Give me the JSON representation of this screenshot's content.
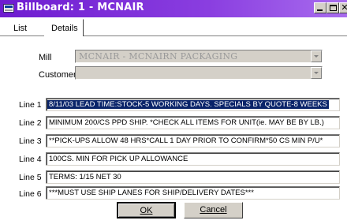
{
  "window": {
    "title": "Billboard: 1 - MCNAIR"
  },
  "tabs": [
    {
      "label": "List"
    },
    {
      "label": "Details"
    }
  ],
  "form": {
    "mill_label": "Mill",
    "mill_value": "MCNAIR - MCNAIRN PACKAGING",
    "customer_label": "Customer",
    "customer_value": ""
  },
  "lines": [
    {
      "label": "Line 1",
      "value": "8/11/03 LEAD TIME:STOCK-5 WORKING DAYS. SPECIALS BY QUOTE-8 WEEKS"
    },
    {
      "label": "Line 2",
      "value": "MINIMUM 200/CS PPD SHIP. *CHECK ALL ITEMS FOR UNIT(ie. MAY BE BY LB.)"
    },
    {
      "label": "Line 3",
      "value": "**PICK-UPS ALLOW 48 HRS*CALL 1 DAY PRIOR TO CONFIRM*50 CS MIN P/U*"
    },
    {
      "label": "Line 4",
      "value": "100CS. MIN FOR PICK UP ALLOWANCE"
    },
    {
      "label": "Line 5",
      "value": "TERMS: 1/15 NET 30"
    },
    {
      "label": "Line 6",
      "value": "***MUST USE SHIP LANES FOR SHIP/DELIVERY DATES***"
    }
  ],
  "buttons": {
    "ok": "OK",
    "cancel": "Cancel"
  }
}
